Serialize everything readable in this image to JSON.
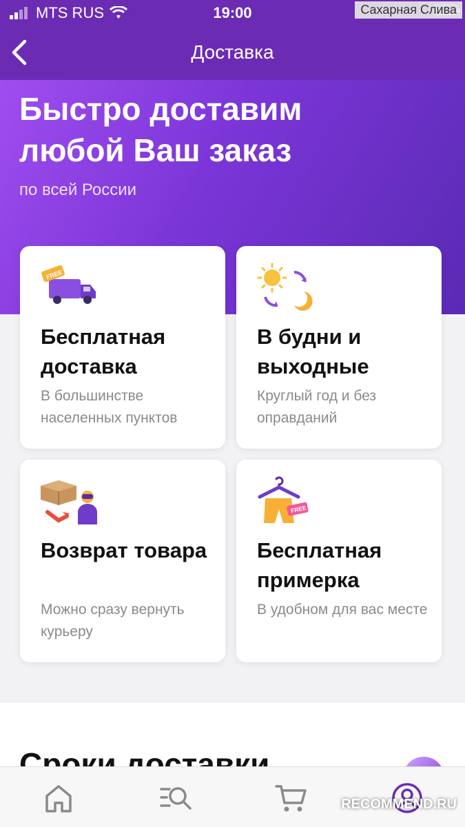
{
  "status_bar": {
    "carrier": "MTS RUS",
    "time": "19:00"
  },
  "watermark": "Сахарная Слива",
  "nav": {
    "title": "Доставка",
    "back_icon": "chevron-left-icon"
  },
  "hero": {
    "title": "Быстро доставим любой Ваш заказ",
    "subtitle": "по всей России"
  },
  "cards": [
    {
      "title": "Бесплатная доставка",
      "description": "В большинстве населенных пунктов",
      "icon": "truck-free-icon",
      "badge": "FREE"
    },
    {
      "title": "В будни и выходные",
      "description": "Круглый год и без оправданий",
      "icon": "sun-moon-icon"
    },
    {
      "title": "Возврат товара",
      "description": "Можно сразу вернуть курьеру",
      "icon": "box-courier-icon"
    },
    {
      "title": "Бесплатная примерка",
      "description": "В удобном для вас месте",
      "icon": "hanger-clothes-icon",
      "badge": "FREE"
    }
  ],
  "section": {
    "title": "Сроки доставки"
  },
  "tabs": [
    {
      "name": "home",
      "icon": "home-icon"
    },
    {
      "name": "catalog-search",
      "icon": "catalog-search-icon"
    },
    {
      "name": "cart",
      "icon": "cart-icon"
    },
    {
      "name": "profile",
      "icon": "profile-icon"
    }
  ],
  "recommend_watermark": "RECOMMEND.RU",
  "colors": {
    "brand": "#6c2bb3",
    "hero_start": "#a04df0",
    "hero_end": "#5a2ab4",
    "text_muted": "#8a8a8a"
  }
}
